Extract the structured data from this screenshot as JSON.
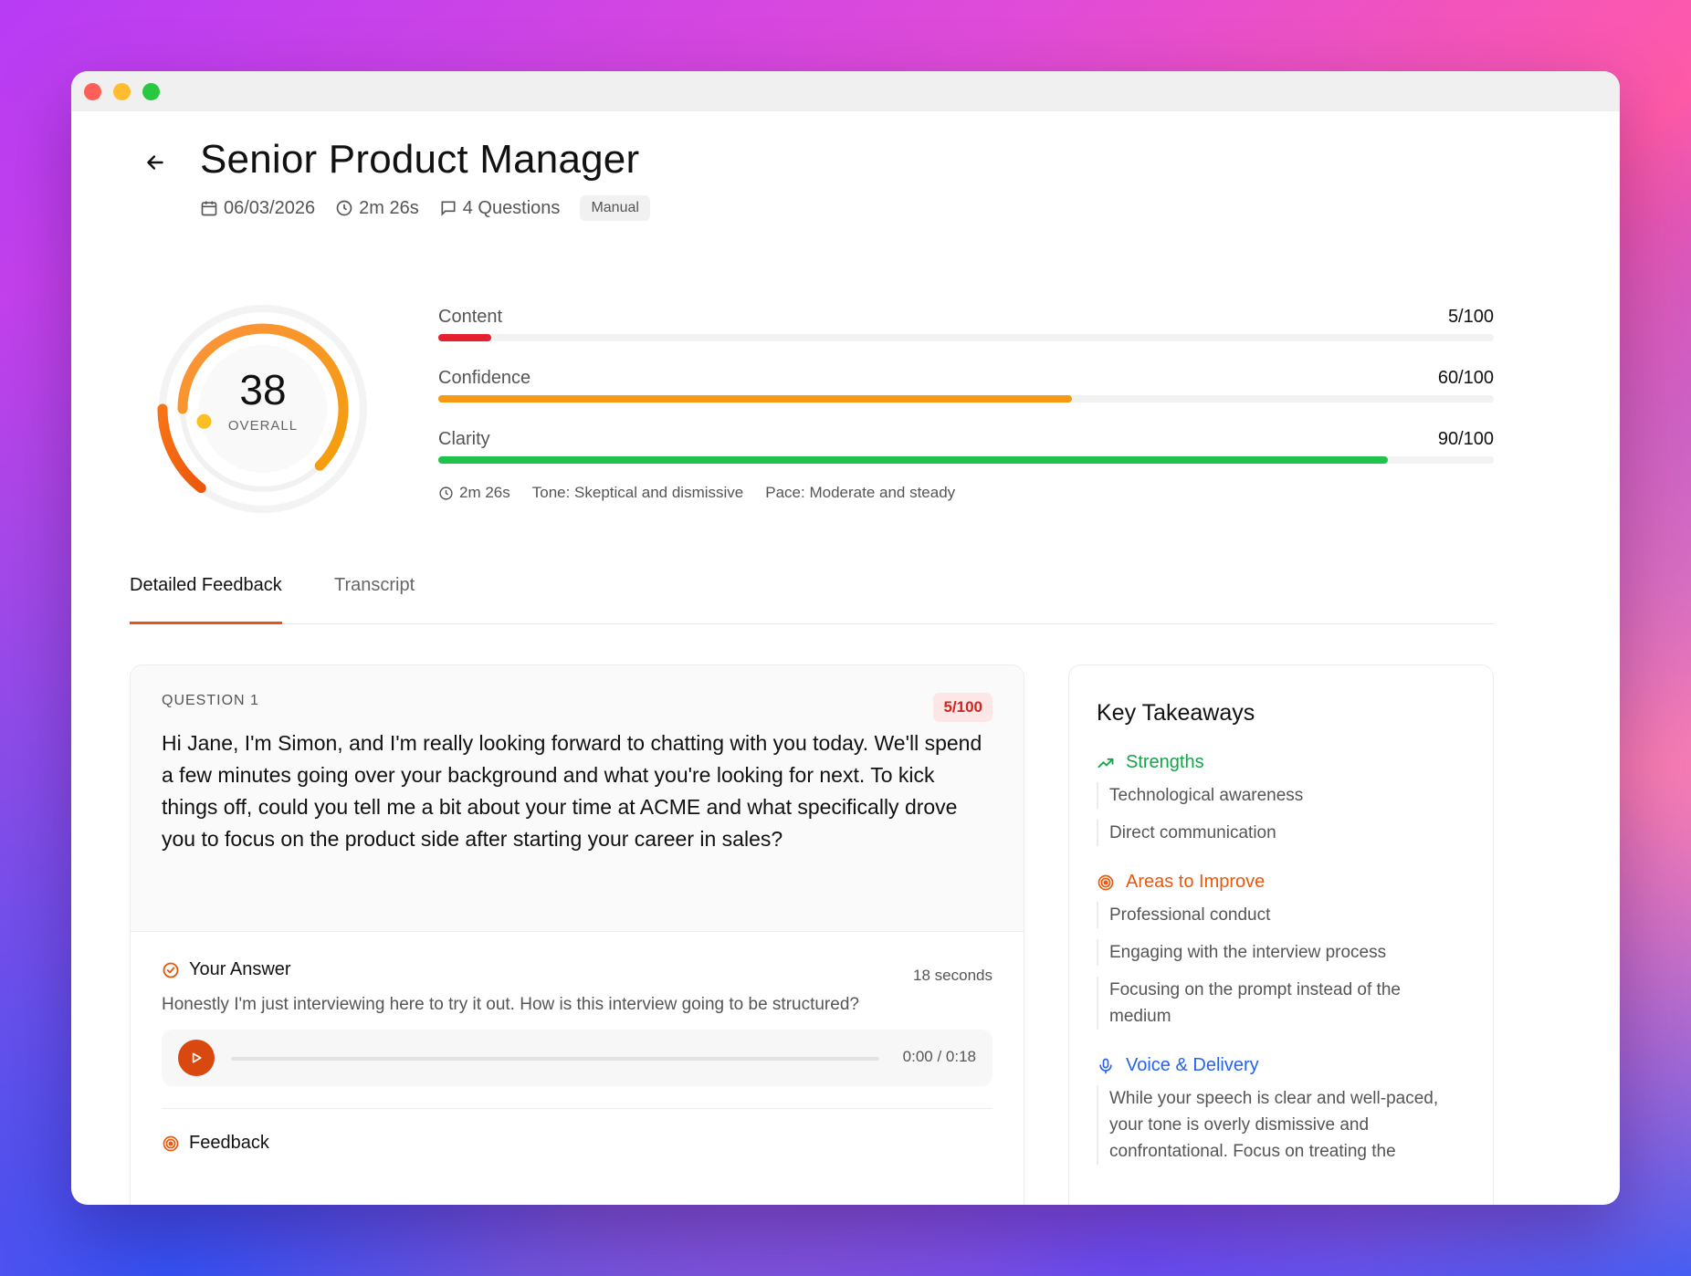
{
  "header": {
    "title": "Senior Product Manager",
    "date": "06/03/2026",
    "duration": "2m 26s",
    "questions": "4 Questions",
    "mode": "Manual"
  },
  "score": {
    "overall": "38",
    "overall_label": "OVERALL",
    "overall_value": 38
  },
  "metrics": [
    {
      "label": "Content",
      "value_text": "5/100",
      "value": 5,
      "color": "#e5202f"
    },
    {
      "label": "Confidence",
      "value_text": "60/100",
      "value": 60,
      "color": "#f59a12"
    },
    {
      "label": "Clarity",
      "value_text": "90/100",
      "value": 90,
      "color": "#1fc24a"
    }
  ],
  "stats": {
    "duration": "2m 26s",
    "tone": "Tone: Skeptical and dismissive",
    "pace": "Pace: Moderate and steady"
  },
  "tabs": [
    {
      "label": "Detailed Feedback",
      "active": true
    },
    {
      "label": "Transcript",
      "active": false
    }
  ],
  "question": {
    "number": "QUESTION 1",
    "score": "5/100",
    "text": "Hi Jane, I'm Simon, and I'm really looking forward to chatting with you today. We'll spend a few minutes going over your background and what you're looking for next. To kick things off, could you tell me a bit about your time at ACME and what specifically drove you to focus on the product side after starting your career in sales?",
    "answer_label": "Your Answer",
    "answer_time": "18 seconds",
    "answer_text": "Honestly I'm just interviewing here to try it out. How is this interview going to be structured?",
    "player_time": "0:00 / 0:18",
    "feedback_label": "Feedback"
  },
  "takeaways": {
    "title": "Key Takeaways",
    "strengths": {
      "label": "Strengths",
      "color": "#16a34a",
      "items": [
        "Technological awareness",
        "Direct communication"
      ]
    },
    "improve": {
      "label": "Areas to Improve",
      "color": "#ea580c",
      "items": [
        "Professional conduct",
        "Engaging with the interview process",
        "Focusing on the prompt instead of the medium"
      ]
    },
    "voice": {
      "label": "Voice & Delivery",
      "color": "#2563eb",
      "text": "While your speech is clear and well-paced, your tone is overly dismissive and confrontational. Focus on treating the"
    }
  },
  "icons": {
    "back": "arrow-left-icon",
    "date": "calendar-icon",
    "duration": "clock-icon",
    "questions": "chat-bubble-icon",
    "strengths": "trending-up-icon",
    "improve": "target-icon",
    "voice": "microphone-icon",
    "answer": "check-circle-icon",
    "play": "play-icon"
  }
}
